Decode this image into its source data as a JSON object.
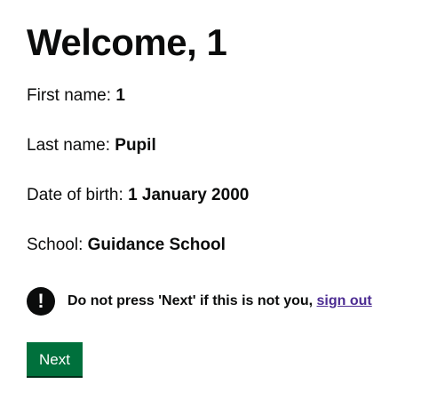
{
  "heading": "Welcome, 1",
  "details": {
    "first_name": {
      "label": "First name:",
      "value": "1"
    },
    "last_name": {
      "label": "Last name:",
      "value": "Pupil"
    },
    "date_of_birth": {
      "label": "Date of birth:",
      "value": "1 January 2000"
    },
    "school": {
      "label": "School:",
      "value": "Guidance School"
    }
  },
  "warning": {
    "icon": "!",
    "text": "Do not press 'Next' if this is not you,",
    "link": "sign out"
  },
  "next_button": "Next",
  "colors": {
    "text": "#0b0c0c",
    "link": "#4c2c92",
    "button": "#00703c"
  }
}
